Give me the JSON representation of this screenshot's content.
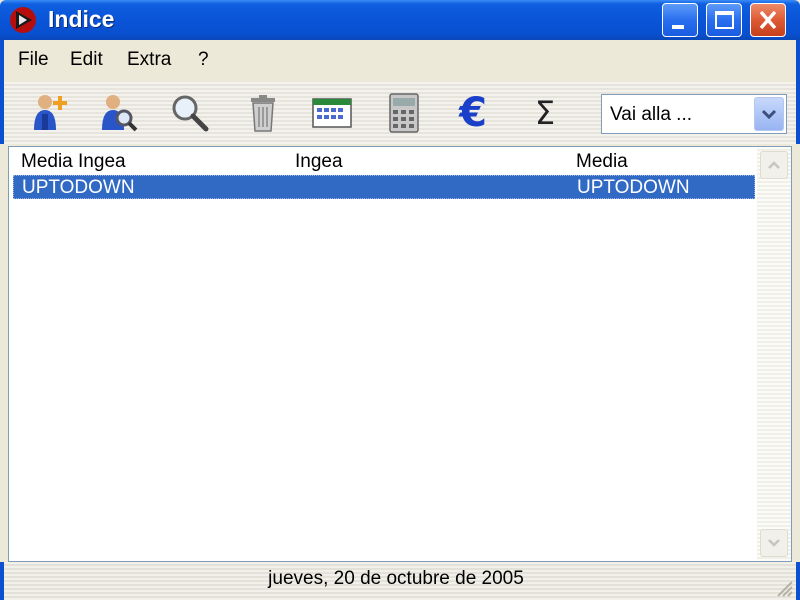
{
  "window": {
    "title": "Indice"
  },
  "menu": [
    {
      "label": "File"
    },
    {
      "label": "Edit"
    },
    {
      "label": "Extra"
    },
    {
      "label": "?"
    }
  ],
  "toolbar": {
    "icons": [
      "add-user-icon",
      "search-user-icon",
      "magnifier-icon",
      "trash-icon",
      "calendar-icon",
      "calculator-icon",
      "euro-icon",
      "sigma-icon"
    ],
    "euro_symbol": "€",
    "sigma_symbol": "Σ",
    "combo": {
      "value": "Vai alla ..."
    }
  },
  "list": {
    "columns": [
      "Media Ingea",
      "Ingea",
      "Media"
    ],
    "rows": [
      {
        "col1": "UPTODOWN",
        "col2": "",
        "col3": "UPTODOWN",
        "selected": true
      }
    ]
  },
  "status": {
    "text": "jueves, 20 de octubre de 2005"
  },
  "colors": {
    "selection": "#316ac5",
    "titlebar": "#0a54d8",
    "close": "#de5a35"
  }
}
